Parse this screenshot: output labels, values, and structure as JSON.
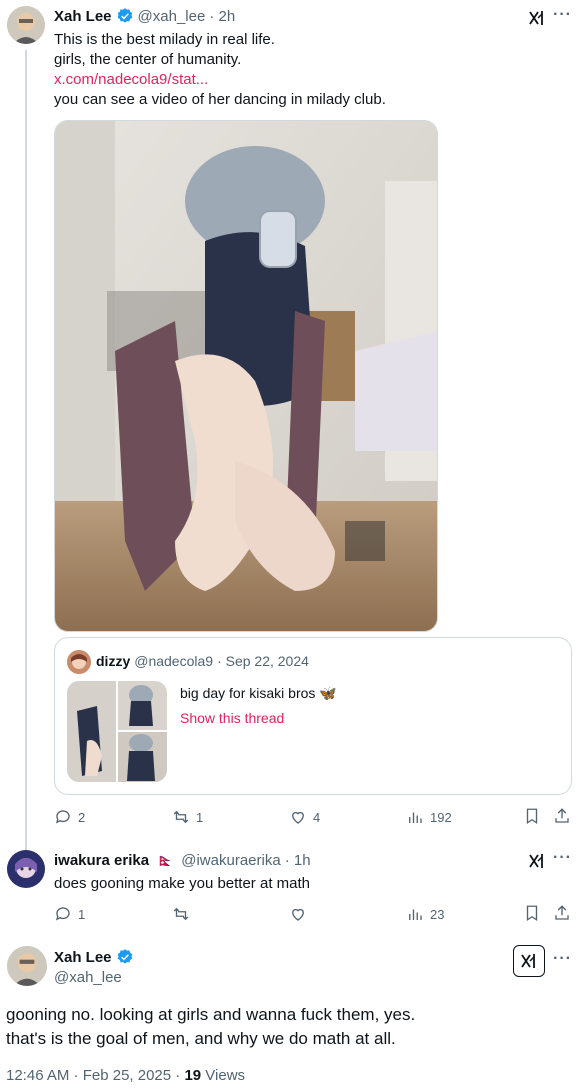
{
  "tweet1": {
    "name": "Xah Lee",
    "handle": "@xah_lee",
    "time": "· 2h",
    "lines": [
      "This is the best milady in real life.",
      "girls, the center of humanity."
    ],
    "link": "x.com/nadecola9/stat...",
    "line_after": "you can see a video of her dancing in milady club.",
    "actions": {
      "replies": "2",
      "reposts": "1",
      "likes": "4",
      "views": "192"
    }
  },
  "quote": {
    "name": "dizzy",
    "handle": "@nadecola9",
    "date": "· Sep 22, 2024",
    "text": "big day for kisaki bros 🦋",
    "show_thread": "Show this thread"
  },
  "tweet2": {
    "name": "iwakura erika",
    "flag": "🇳🇵",
    "handle": "@iwakuraerika",
    "time": "· 1h",
    "text": "does gooning make you better at math",
    "actions": {
      "replies": "1",
      "reposts": "",
      "likes": "",
      "views": "23"
    }
  },
  "tweet3": {
    "name": "Xah Lee",
    "handle": "@xah_lee",
    "line1": "gooning no. looking at girls and wanna fuck them, yes.",
    "line2": "that's is the goal of men, and why we do math at all.",
    "timestamp": "12:46 AM · Feb 25, 2025 · ",
    "views_count": "19",
    "views_label": " Views"
  },
  "colors": {
    "verified": "#1d9bf0",
    "link": "#e0245e",
    "muted": "#536471"
  },
  "icons": [
    "verified-badge-icon",
    "grok-icon",
    "more-icon",
    "reply-icon",
    "repost-icon",
    "like-icon",
    "views-icon",
    "bookmark-icon",
    "share-icon"
  ]
}
